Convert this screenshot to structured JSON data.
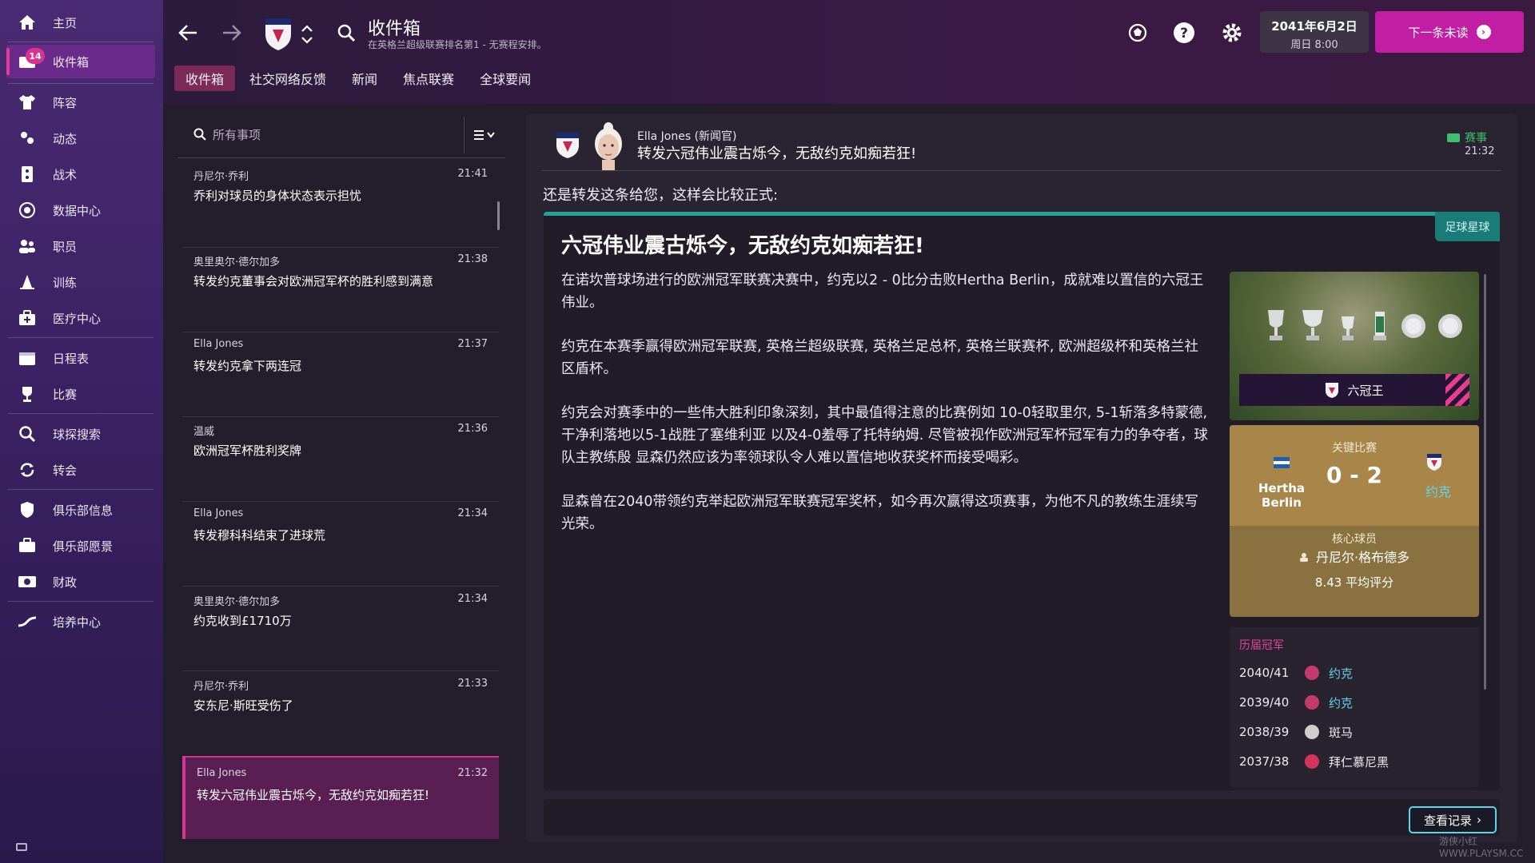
{
  "sidebar": {
    "items": [
      {
        "label": "主页",
        "icon": "home-icon"
      },
      {
        "label": "收件箱",
        "icon": "inbox-icon",
        "badge": "14"
      },
      {
        "label": "阵容",
        "icon": "squad-shirt-icon"
      },
      {
        "label": "动态",
        "icon": "dynamics-icon"
      },
      {
        "label": "战术",
        "icon": "tactics-board-icon"
      },
      {
        "label": "数据中心",
        "icon": "data-hub-icon"
      },
      {
        "label": "职员",
        "icon": "staff-icon"
      },
      {
        "label": "训练",
        "icon": "training-cone-icon"
      },
      {
        "label": "医疗中心",
        "icon": "medical-bag-icon"
      },
      {
        "label": "日程表",
        "icon": "calendar-icon"
      },
      {
        "label": "比赛",
        "icon": "trophy-icon"
      },
      {
        "label": "球探搜索",
        "icon": "search-icon"
      },
      {
        "label": "转会",
        "icon": "transfer-icon"
      },
      {
        "label": "俱乐部信息",
        "icon": "shield-icon"
      },
      {
        "label": "俱乐部愿景",
        "icon": "briefcase-icon"
      },
      {
        "label": "财政",
        "icon": "money-icon"
      },
      {
        "label": "培养中心",
        "icon": "development-icon"
      }
    ]
  },
  "header": {
    "title": "收件箱",
    "subtitle": "在英格兰超级联赛排名第1 - 无赛程安排。",
    "date": "2041年6月2日",
    "weekday_time": "周日 8:00",
    "next_label": "下一条未读",
    "tabs": [
      "收件箱",
      "社交网络反馈",
      "新闻",
      "焦点联赛",
      "全球要闻"
    ]
  },
  "list": {
    "search_placeholder": "所有事项",
    "messages": [
      {
        "from": "丹尼尔·乔利",
        "time": "21:41",
        "subject": "乔利对球员的身体状态表示担忧"
      },
      {
        "from": "奥里奥尔·德尔加多",
        "time": "21:38",
        "subject": "转发约克董事会对欧洲冠军杯的胜利感到满意"
      },
      {
        "from": "Ella Jones",
        "time": "21:37",
        "subject": "转发约克拿下两连冠"
      },
      {
        "from": "温威",
        "time": "21:36",
        "subject": "欧洲冠军杯胜利奖牌"
      },
      {
        "from": "Ella Jones",
        "time": "21:34",
        "subject": "转发穆科科结束了进球荒"
      },
      {
        "from": "奥里奥尔·德尔加多",
        "time": "21:34",
        "subject": "约克收到£1710万"
      },
      {
        "from": "丹尼尔·乔利",
        "time": "21:33",
        "subject": "安东尼·斯旺受伤了"
      },
      {
        "from": "Ella Jones",
        "time": "21:32",
        "subject": "转发六冠伟业震古烁今，无敌约克如痴若狂!"
      }
    ]
  },
  "detail": {
    "sender": "Ella Jones (新闻官)",
    "subject": "转发六冠伟业震古烁今，无敌约克如痴若狂!",
    "category": "赛事",
    "time": "21:32",
    "intro": "还是转发这条给您，这样会比较正式:",
    "article": {
      "tag": "足球星球",
      "headline": "六冠伟业震古烁今，无敌约克如痴若狂!",
      "p1": "在诺坎普球场进行的欧洲冠军联赛决赛中，约克以2 - 0比分击败Hertha Berlin，成就难以置信的六冠王伟业。",
      "p2": "约克在本赛季赢得欧洲冠军联赛, 英格兰超级联赛, 英格兰足总杯, 英格兰联赛杯, 欧洲超级杯和英格兰社区盾杯。",
      "p3": "约克会对赛季中的一些伟大胜利印象深刻，其中最值得注意的比赛例如 10-0轻取里尔, 5-1斩落多特蒙德, 干净利落地以5-1战胜了塞维利亚 以及4-0羞辱了托特纳姆. 尽管被视作欧洲冠军杯冠军有力的争夺者，球队主教练殷 显森仍然应该为率领球队令人难以置信地收获奖杯而接受喝彩。",
      "p4": "显森曾在2040带领约克举起欧洲冠军联赛冠军奖杯，如今再次赢得这项赛事，为他不凡的教练生涯续写光荣。"
    },
    "trophy_banner": "六冠王",
    "key_match": {
      "label": "关键比赛",
      "home": "Hertha Berlin",
      "score": "0 - 2",
      "away": "约克",
      "key_player_label": "核心球员",
      "player": "丹尼尔·格布德多",
      "rating": "8.43 平均评分"
    },
    "past_winners": {
      "title": "历届冠军",
      "rows": [
        {
          "season": "2040/41",
          "team": "约克",
          "link": true,
          "color": "#c23a6e"
        },
        {
          "season": "2039/40",
          "team": "约克",
          "link": true,
          "color": "#c23a6e"
        },
        {
          "season": "2038/39",
          "team": "斑马",
          "link": false,
          "color": "#cfcfcf"
        },
        {
          "season": "2037/38",
          "team": "拜仁慕尼黑",
          "link": false,
          "color": "#d4345a"
        }
      ]
    },
    "records_button": "查看记录"
  },
  "watermark": "游侠小红 WWW.PLAYSM.CC",
  "colors": {
    "accent": "#c21ea5",
    "teal": "#1fa39a",
    "link": "#5fd3e8",
    "category": "#3dbf6c"
  }
}
